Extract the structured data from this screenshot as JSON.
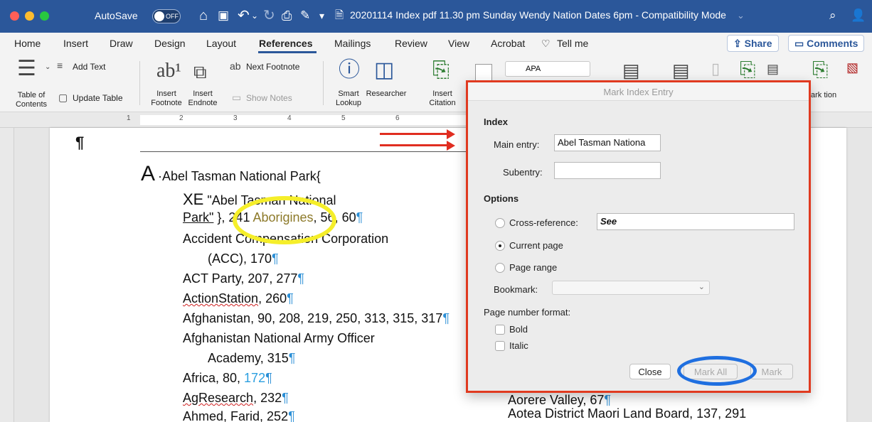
{
  "titlebar": {
    "autosave_label": "AutoSave",
    "toggle_state": "OFF",
    "document_title": "20201114 Index pdf 11.30 pm Sunday Wendy Nation Dates 6pm - Compatibility Mode",
    "colors": {
      "bar": "#2b579a",
      "close": "#ff5f57",
      "minimize": "#febc2e",
      "zoom": "#28c840"
    }
  },
  "tabs": {
    "items": [
      "Home",
      "Insert",
      "Draw",
      "Design",
      "Layout",
      "References",
      "Mailings",
      "Review",
      "View",
      "Acrobat"
    ],
    "active": "References",
    "tell_me": "Tell me",
    "share": "Share",
    "comments": "Comments"
  },
  "ribbon": {
    "toc": "Table of Contents",
    "add_text": "Add Text",
    "update_table": "Update Table",
    "insert_footnote": "Insert Footnote",
    "insert_endnote": "Insert Endnote",
    "next_footnote": "Next Footnote",
    "show_notes": "Show Notes",
    "smart_lookup": "Smart Lookup",
    "researcher": "Researcher",
    "insert_citation": "Insert Citation",
    "citation_style": "APA",
    "mark_citation_partial": "ark tion"
  },
  "ruler": {
    "numbers": [
      "1",
      "2",
      "3",
      "4",
      "5",
      "6"
    ]
  },
  "document": {
    "dropcap": "A",
    "line1": "Abel Tasman National Park",
    "line2_xe": "XE",
    "line2_text": "\"Abel Tasman National",
    "line3_start": "Park\"",
    "line3_pages": ", 241",
    "line3_highlight": "Aborigines",
    "line3_end": ", 56, 60",
    "line4": "Accident Compensation Corporation",
    "line5": "(ACC), 170",
    "line6": "ACT Party, 207, 277",
    "line7_a": "ActionStation",
    "line7_b": ", 260",
    "line8": "Afghanistan, 90, 208, 219, 250, 313, 315, 317",
    "line9": "Afghanistan National Army Officer",
    "line10": "Academy, 315",
    "line11_a": "Africa, 80, ",
    "line11_b": "172",
    "line12_a": "AgResearch",
    "line12_b": ", 232",
    "line13": "Ahmed, Farid, 252",
    "right_line1": "Aorere Valley, 67",
    "right_line2": "Aotea District Maori Land Board, 137, 291"
  },
  "dialog": {
    "title": "Mark Index Entry",
    "index_section": "Index",
    "main_entry_label": "Main entry:",
    "main_entry_value": "Abel Tasman Nationa",
    "subentry_label": "Subentry:",
    "subentry_value": "",
    "options_section": "Options",
    "cross_reference_label": "Cross-reference:",
    "cross_reference_value": "See",
    "current_page_label": "Current page",
    "page_range_label": "Page range",
    "bookmark_label": "Bookmark:",
    "page_number_format_label": "Page number format:",
    "bold_label": "Bold",
    "italic_label": "Italic",
    "close_button": "Close",
    "mark_all_button": "Mark All",
    "mark_button": "Mark",
    "selected_option": "Current page"
  }
}
